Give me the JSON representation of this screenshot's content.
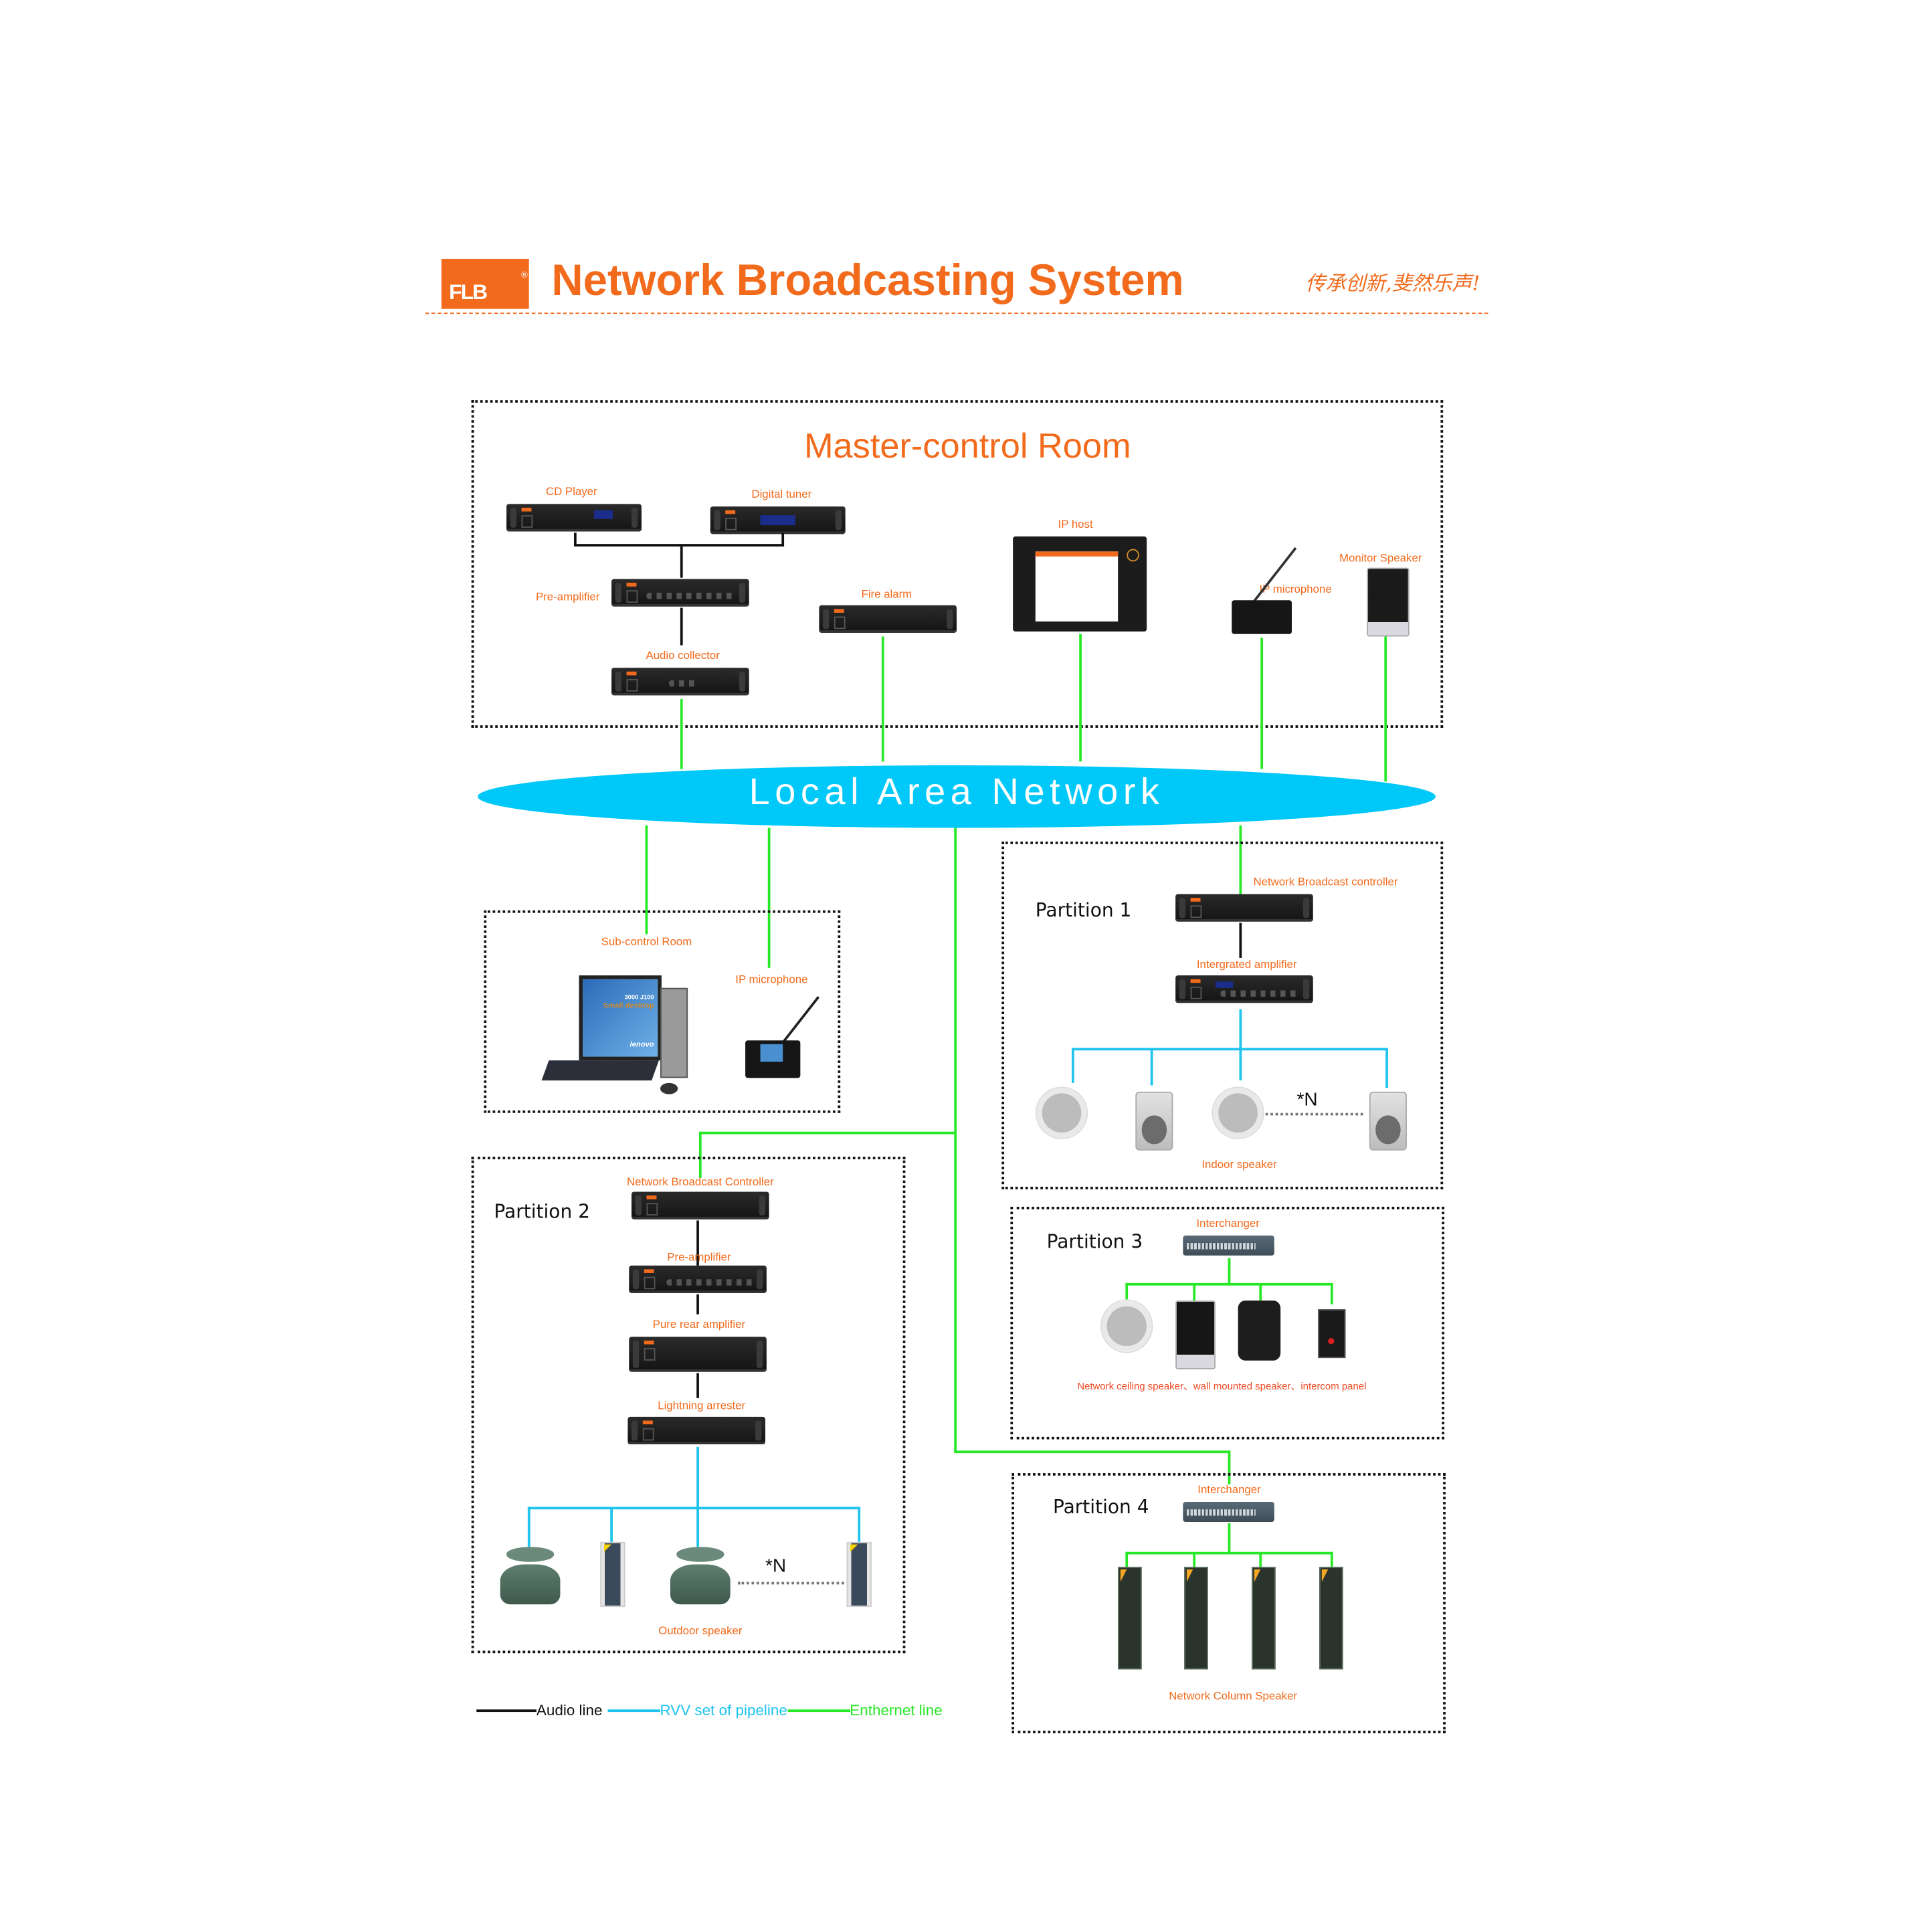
{
  "header": {
    "logo_text": "FLB",
    "registered_mark": "®",
    "title": "Network Broadcasting System",
    "slogan": "传承创新,斐然乐声!"
  },
  "master_room": {
    "title": "Master-control Room",
    "devices": {
      "cd_player": "CD Player",
      "digital_tuner": "Digital tuner",
      "pre_amplifier": "Pre-amplifier",
      "audio_collector": "Audio collector",
      "fire_alarm": "Fire alarm",
      "ip_host": "IP host",
      "ip_microphone": "IP microphone",
      "monitor_speaker": "Monitor Speaker"
    }
  },
  "lan": {
    "label": "Local Area Network"
  },
  "sub_control": {
    "title": "Sub-control Room",
    "ip_microphone": "IP microphone",
    "pc_screen_line1": "3000 J100",
    "pc_screen_line2": "Small desktop",
    "pc_brand": "lenovo"
  },
  "partition1": {
    "title": "Partition 1",
    "controller": "Network Broadcast controller",
    "amplifier": "Intergrated amplifier",
    "multiplier": "*N",
    "speakers_label": "Indoor speaker"
  },
  "partition2": {
    "title": "Partition 2",
    "controller": "Network Broadcast Controller",
    "pre_amplifier": "Pre-amplifier",
    "pure_rear_amplifier": "Pure rear amplifier",
    "lightning_arrester": "Lightning arrester",
    "multiplier": "*N",
    "speakers_label": "Outdoor speaker"
  },
  "partition3": {
    "title": "Partition 3",
    "switch": "Interchanger",
    "devices_label": "Network ceiling speaker、wall mounted speaker、intercom panel"
  },
  "partition4": {
    "title": "Partition 4",
    "switch": "Interchanger",
    "devices_label": "Network Column Speaker"
  },
  "legend": {
    "items": [
      {
        "label": "Audio line",
        "color": "#111111"
      },
      {
        "label": "RVV set of pipeline",
        "color": "#1ec3ee"
      },
      {
        "label": "Enthernet line",
        "color": "#27e827"
      }
    ]
  },
  "colors": {
    "brand": "#f26a1b",
    "lan": "#00c8f8",
    "ethernet": "#27e827",
    "rvv": "#1ec3ee",
    "audio": "#111111"
  }
}
